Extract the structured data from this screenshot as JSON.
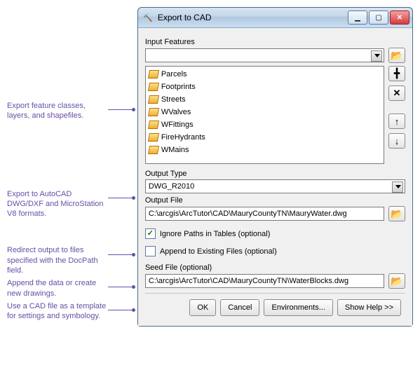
{
  "window": {
    "title": "Export to CAD",
    "min_tip": "Minimize",
    "max_tip": "Maximize",
    "close_tip": "Close"
  },
  "annotations": {
    "a1": "Export feature classes, layers, and shapefiles.",
    "a2": "Export to AutoCAD DWG/DXF and MicroStation V8 formats.",
    "a3": "Redirect output to files specified with the DocPath field.",
    "a4": "Append the data or create new drawings.",
    "a5": "Use a CAD file as a template for settings and symbology."
  },
  "labels": {
    "input_features": "Input Features",
    "output_type": "Output Type",
    "output_file": "Output File",
    "ignore_paths": "Ignore Paths in Tables (optional)",
    "append": "Append to Existing Files (optional)",
    "seed_file": "Seed File (optional)"
  },
  "input_combo": {
    "value": ""
  },
  "feature_list": [
    "Parcels",
    "Footprints",
    "Streets",
    "WValves",
    "WFittings",
    "FireHydrants",
    "WMains"
  ],
  "output_type": {
    "value": "DWG_R2010"
  },
  "output_file": {
    "value": "C:\\arcgis\\ArcTutor\\CAD\\MauryCountyTN\\MauryWater.dwg"
  },
  "ignore_paths_checked": true,
  "append_checked": false,
  "seed_file": {
    "value": "C:\\arcgis\\ArcTutor\\CAD\\MauryCountyTN\\WaterBlocks.dwg"
  },
  "buttons": {
    "ok": "OK",
    "cancel": "Cancel",
    "env": "Environments...",
    "help": "Show Help >>"
  },
  "icons": {
    "browse": "📂",
    "add": "╋",
    "remove": "✕",
    "up": "↑",
    "down": "↓",
    "tool": "🔨"
  }
}
